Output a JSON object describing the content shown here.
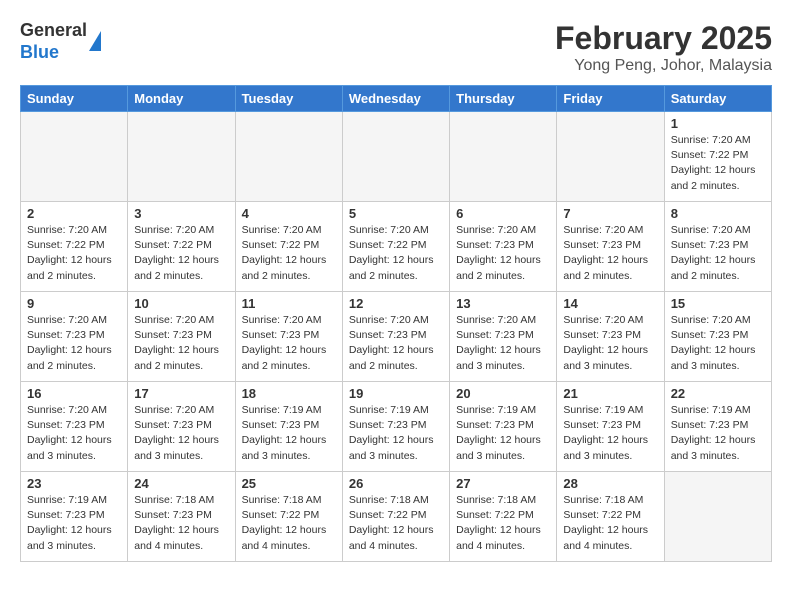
{
  "header": {
    "logo_line1": "General",
    "logo_line2": "Blue",
    "month": "February 2025",
    "location": "Yong Peng, Johor, Malaysia"
  },
  "weekdays": [
    "Sunday",
    "Monday",
    "Tuesday",
    "Wednesday",
    "Thursday",
    "Friday",
    "Saturday"
  ],
  "weeks": [
    [
      {
        "day": "",
        "info": ""
      },
      {
        "day": "",
        "info": ""
      },
      {
        "day": "",
        "info": ""
      },
      {
        "day": "",
        "info": ""
      },
      {
        "day": "",
        "info": ""
      },
      {
        "day": "",
        "info": ""
      },
      {
        "day": "1",
        "info": "Sunrise: 7:20 AM\nSunset: 7:22 PM\nDaylight: 12 hours\nand 2 minutes."
      }
    ],
    [
      {
        "day": "2",
        "info": "Sunrise: 7:20 AM\nSunset: 7:22 PM\nDaylight: 12 hours\nand 2 minutes."
      },
      {
        "day": "3",
        "info": "Sunrise: 7:20 AM\nSunset: 7:22 PM\nDaylight: 12 hours\nand 2 minutes."
      },
      {
        "day": "4",
        "info": "Sunrise: 7:20 AM\nSunset: 7:22 PM\nDaylight: 12 hours\nand 2 minutes."
      },
      {
        "day": "5",
        "info": "Sunrise: 7:20 AM\nSunset: 7:22 PM\nDaylight: 12 hours\nand 2 minutes."
      },
      {
        "day": "6",
        "info": "Sunrise: 7:20 AM\nSunset: 7:23 PM\nDaylight: 12 hours\nand 2 minutes."
      },
      {
        "day": "7",
        "info": "Sunrise: 7:20 AM\nSunset: 7:23 PM\nDaylight: 12 hours\nand 2 minutes."
      },
      {
        "day": "8",
        "info": "Sunrise: 7:20 AM\nSunset: 7:23 PM\nDaylight: 12 hours\nand 2 minutes."
      }
    ],
    [
      {
        "day": "9",
        "info": "Sunrise: 7:20 AM\nSunset: 7:23 PM\nDaylight: 12 hours\nand 2 minutes."
      },
      {
        "day": "10",
        "info": "Sunrise: 7:20 AM\nSunset: 7:23 PM\nDaylight: 12 hours\nand 2 minutes."
      },
      {
        "day": "11",
        "info": "Sunrise: 7:20 AM\nSunset: 7:23 PM\nDaylight: 12 hours\nand 2 minutes."
      },
      {
        "day": "12",
        "info": "Sunrise: 7:20 AM\nSunset: 7:23 PM\nDaylight: 12 hours\nand 2 minutes."
      },
      {
        "day": "13",
        "info": "Sunrise: 7:20 AM\nSunset: 7:23 PM\nDaylight: 12 hours\nand 3 minutes."
      },
      {
        "day": "14",
        "info": "Sunrise: 7:20 AM\nSunset: 7:23 PM\nDaylight: 12 hours\nand 3 minutes."
      },
      {
        "day": "15",
        "info": "Sunrise: 7:20 AM\nSunset: 7:23 PM\nDaylight: 12 hours\nand 3 minutes."
      }
    ],
    [
      {
        "day": "16",
        "info": "Sunrise: 7:20 AM\nSunset: 7:23 PM\nDaylight: 12 hours\nand 3 minutes."
      },
      {
        "day": "17",
        "info": "Sunrise: 7:20 AM\nSunset: 7:23 PM\nDaylight: 12 hours\nand 3 minutes."
      },
      {
        "day": "18",
        "info": "Sunrise: 7:19 AM\nSunset: 7:23 PM\nDaylight: 12 hours\nand 3 minutes."
      },
      {
        "day": "19",
        "info": "Sunrise: 7:19 AM\nSunset: 7:23 PM\nDaylight: 12 hours\nand 3 minutes."
      },
      {
        "day": "20",
        "info": "Sunrise: 7:19 AM\nSunset: 7:23 PM\nDaylight: 12 hours\nand 3 minutes."
      },
      {
        "day": "21",
        "info": "Sunrise: 7:19 AM\nSunset: 7:23 PM\nDaylight: 12 hours\nand 3 minutes."
      },
      {
        "day": "22",
        "info": "Sunrise: 7:19 AM\nSunset: 7:23 PM\nDaylight: 12 hours\nand 3 minutes."
      }
    ],
    [
      {
        "day": "23",
        "info": "Sunrise: 7:19 AM\nSunset: 7:23 PM\nDaylight: 12 hours\nand 3 minutes."
      },
      {
        "day": "24",
        "info": "Sunrise: 7:18 AM\nSunset: 7:23 PM\nDaylight: 12 hours\nand 4 minutes."
      },
      {
        "day": "25",
        "info": "Sunrise: 7:18 AM\nSunset: 7:22 PM\nDaylight: 12 hours\nand 4 minutes."
      },
      {
        "day": "26",
        "info": "Sunrise: 7:18 AM\nSunset: 7:22 PM\nDaylight: 12 hours\nand 4 minutes."
      },
      {
        "day": "27",
        "info": "Sunrise: 7:18 AM\nSunset: 7:22 PM\nDaylight: 12 hours\nand 4 minutes."
      },
      {
        "day": "28",
        "info": "Sunrise: 7:18 AM\nSunset: 7:22 PM\nDaylight: 12 hours\nand 4 minutes."
      },
      {
        "day": "",
        "info": ""
      }
    ]
  ]
}
